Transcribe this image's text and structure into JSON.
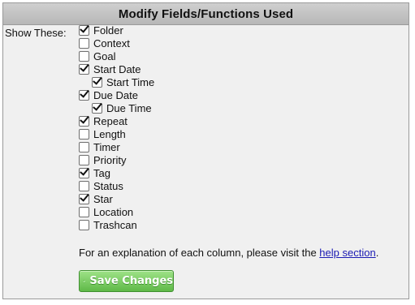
{
  "panel": {
    "title": "Modify Fields/Functions Used",
    "show_label": "Show These:"
  },
  "fields": [
    {
      "label": "Folder",
      "checked": true,
      "indent": 0
    },
    {
      "label": "Context",
      "checked": false,
      "indent": 0
    },
    {
      "label": "Goal",
      "checked": false,
      "indent": 0
    },
    {
      "label": "Start Date",
      "checked": true,
      "indent": 0
    },
    {
      "label": "Start Time",
      "checked": true,
      "indent": 1
    },
    {
      "label": "Due Date",
      "checked": true,
      "indent": 0
    },
    {
      "label": "Due Time",
      "checked": true,
      "indent": 1
    },
    {
      "label": "Repeat",
      "checked": true,
      "indent": 0
    },
    {
      "label": "Length",
      "checked": false,
      "indent": 0
    },
    {
      "label": "Timer",
      "checked": false,
      "indent": 0
    },
    {
      "label": "Priority",
      "checked": false,
      "indent": 0
    },
    {
      "label": "Tag",
      "checked": true,
      "indent": 0
    },
    {
      "label": "Status",
      "checked": false,
      "indent": 0
    },
    {
      "label": "Star",
      "checked": true,
      "indent": 0
    },
    {
      "label": "Location",
      "checked": false,
      "indent": 0
    },
    {
      "label": "Trashcan",
      "checked": false,
      "indent": 0
    }
  ],
  "explanation": {
    "prefix": "For an explanation of each column, please visit the ",
    "link_text": "help section",
    "suffix": "."
  },
  "save_button": {
    "label": "Save Changes",
    "icon": "checkmark-icon"
  }
}
